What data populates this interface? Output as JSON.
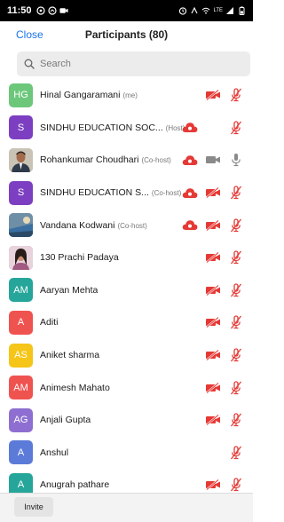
{
  "status_bar": {
    "time": "11:50",
    "right_text": "LTE"
  },
  "header": {
    "close_label": "Close",
    "title": "Participants (80)"
  },
  "search": {
    "placeholder": "Search"
  },
  "colors": {
    "accent": "#1a73e8",
    "muted_red": "#e53935",
    "cloud_red": "#e53935",
    "icon_gray": "#8a8a8a"
  },
  "participants": [
    {
      "initials": "HG",
      "avatar_color": "#6cc77b",
      "photo": false,
      "name": "Hinal Gangaramani",
      "role": "(me)",
      "cloud": false,
      "video": "video-off-icon",
      "audio": "mic-muted-icon"
    },
    {
      "initials": "S",
      "avatar_color": "#7d3fc1",
      "photo": false,
      "name": "SINDHU EDUCATION SOC...",
      "role": "(Host)",
      "cloud": true,
      "video": "",
      "audio": "mic-muted-icon"
    },
    {
      "initials": "",
      "avatar_color": "#b9b2a6",
      "photo": true,
      "name": "Rohankumar Choudhari",
      "role": "(Co-host)",
      "cloud": true,
      "video": "video-on-icon",
      "audio": "mic-on-icon"
    },
    {
      "initials": "S",
      "avatar_color": "#7d3fc1",
      "photo": false,
      "name": "SINDHU EDUCATION S...",
      "role": "(Co-host)",
      "cloud": true,
      "video": "video-off-icon",
      "audio": "mic-muted-icon"
    },
    {
      "initials": "",
      "avatar_color": "#8aa6b8",
      "photo": true,
      "name": "Vandana Kodwani",
      "role": "(Co-host)",
      "cloud": true,
      "video": "video-off-icon",
      "audio": "mic-muted-icon"
    },
    {
      "initials": "",
      "avatar_color": "#a15a82",
      "photo": true,
      "name": "130 Prachi Padaya",
      "role": "",
      "cloud": false,
      "video": "video-off-icon",
      "audio": "mic-muted-icon"
    },
    {
      "initials": "AM",
      "avatar_color": "#26a69a",
      "photo": false,
      "name": "Aaryan Mehta",
      "role": "",
      "cloud": false,
      "video": "video-off-icon",
      "audio": "mic-muted-icon"
    },
    {
      "initials": "A",
      "avatar_color": "#ef5350",
      "photo": false,
      "name": "Aditi",
      "role": "",
      "cloud": false,
      "video": "video-off-icon",
      "audio": "mic-muted-icon"
    },
    {
      "initials": "AS",
      "avatar_color": "#f5c518",
      "photo": false,
      "name": "Aniket sharma",
      "role": "",
      "cloud": false,
      "video": "video-off-icon",
      "audio": "mic-muted-icon"
    },
    {
      "initials": "AM",
      "avatar_color": "#ef5350",
      "photo": false,
      "name": "Animesh Mahato",
      "role": "",
      "cloud": false,
      "video": "video-off-icon",
      "audio": "mic-muted-icon"
    },
    {
      "initials": "AG",
      "avatar_color": "#8e6fd1",
      "photo": false,
      "name": "Anjali Gupta",
      "role": "",
      "cloud": false,
      "video": "video-off-icon",
      "audio": "mic-muted-icon"
    },
    {
      "initials": "A",
      "avatar_color": "#5c7bd9",
      "photo": false,
      "name": "Anshul",
      "role": "",
      "cloud": false,
      "video": "",
      "audio": "mic-muted-icon"
    },
    {
      "initials": "A",
      "avatar_color": "#26a69a",
      "photo": false,
      "name": "Anugrah  pathare",
      "role": "",
      "cloud": false,
      "video": "video-off-icon",
      "audio": "mic-muted-icon"
    }
  ],
  "footer": {
    "invite_label": "Invite"
  }
}
